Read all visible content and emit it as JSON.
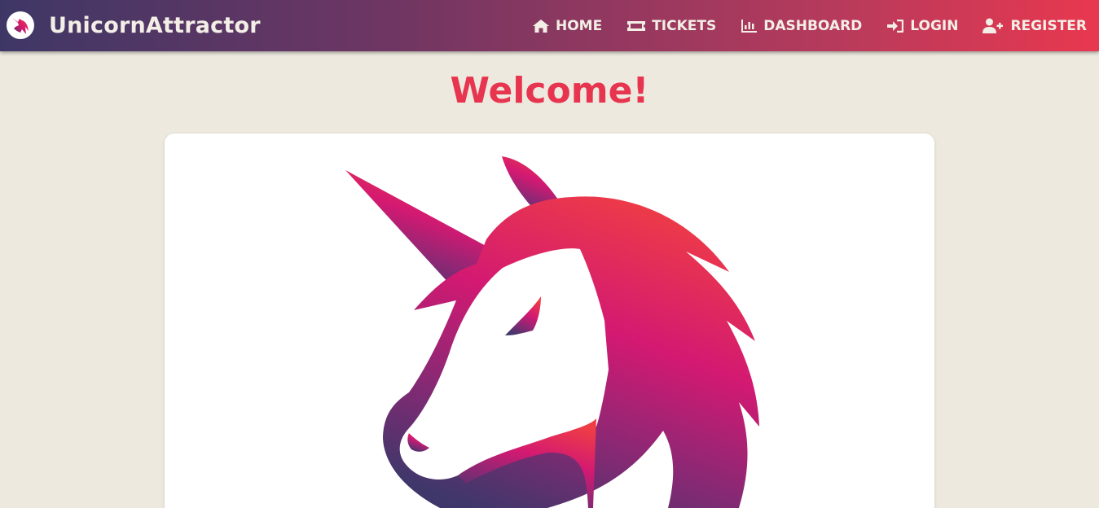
{
  "brand": {
    "title": "UnicornAttractor",
    "logo_icon": "unicorn-icon"
  },
  "nav": {
    "items": [
      {
        "label": "HOME",
        "icon": "home-icon"
      },
      {
        "label": "TICKETS",
        "icon": "ticket-icon"
      },
      {
        "label": "DASHBOARD",
        "icon": "bar-chart-icon"
      },
      {
        "label": "LOGIN",
        "icon": "sign-in-icon"
      },
      {
        "label": "REGISTER",
        "icon": "user-plus-icon"
      }
    ]
  },
  "main": {
    "heading": "Welcome!"
  },
  "colors": {
    "accent": "#e7344f",
    "background": "#ede9df",
    "nav_gradient_start": "#3e3766",
    "nav_gradient_end": "#e8384f"
  }
}
